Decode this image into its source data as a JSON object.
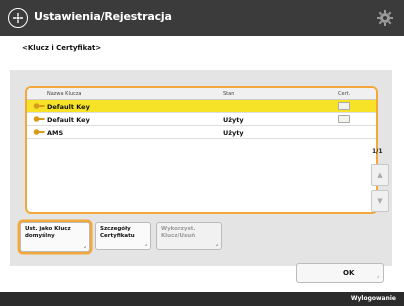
{
  "header": {
    "title": "Ustawienia/Rejestracja",
    "home_icon": "home-icon",
    "settings_icon": "gear-icon"
  },
  "breadcrumb": "<Klucz i Certyfikat>",
  "list": {
    "columns": [
      "Nazwa Klucza",
      "Stan",
      "Cert."
    ],
    "rows": [
      {
        "name": "Default Key",
        "status": "",
        "has_cert": true,
        "selected": true
      },
      {
        "name": "Default Key",
        "status": "Użyty",
        "has_cert": true,
        "selected": false
      },
      {
        "name": "AMS",
        "status": "Użyty",
        "has_cert": false,
        "selected": false
      }
    ]
  },
  "pager": {
    "label": "1/1",
    "up": "▲",
    "down": "▼"
  },
  "buttons": {
    "default_key": "Ust. jako Klucz domyślny",
    "cert_details": "Szczegóły Certyfikatu",
    "delete": "Wykorzyst. Klucz/Usuń"
  },
  "ok_label": "OK",
  "logout_label": "Wylogowanie",
  "colors": {
    "accent_orange": "#f3a83b",
    "selected_row": "#f6e327"
  }
}
